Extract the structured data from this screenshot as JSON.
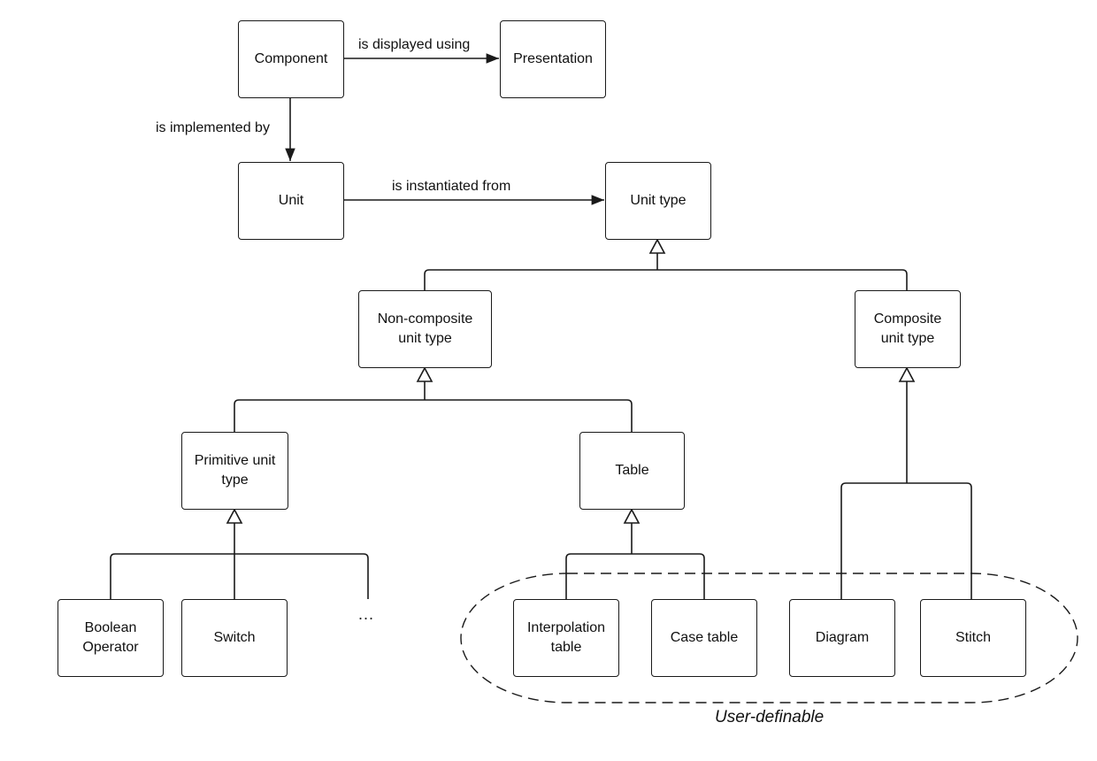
{
  "diagram": {
    "nodes": {
      "component": "Component",
      "presentation": "Presentation",
      "unit": "Unit",
      "unit_type": "Unit type",
      "non_composite": "Non-composite unit type",
      "composite": "Composite unit type",
      "primitive": "Primitive unit type",
      "table": "Table",
      "boolean_operator": "Boolean Operator",
      "switch": "Switch",
      "ellipsis": "...",
      "interpolation_table": "Interpolation table",
      "case_table": "Case table",
      "diagram": "Diagram",
      "stitch": "Stitch"
    },
    "edges": {
      "displayed_using": "is displayed using",
      "implemented_by": "is implemented by",
      "instantiated_from": "is instantiated from"
    },
    "group_caption": "User-definable"
  }
}
